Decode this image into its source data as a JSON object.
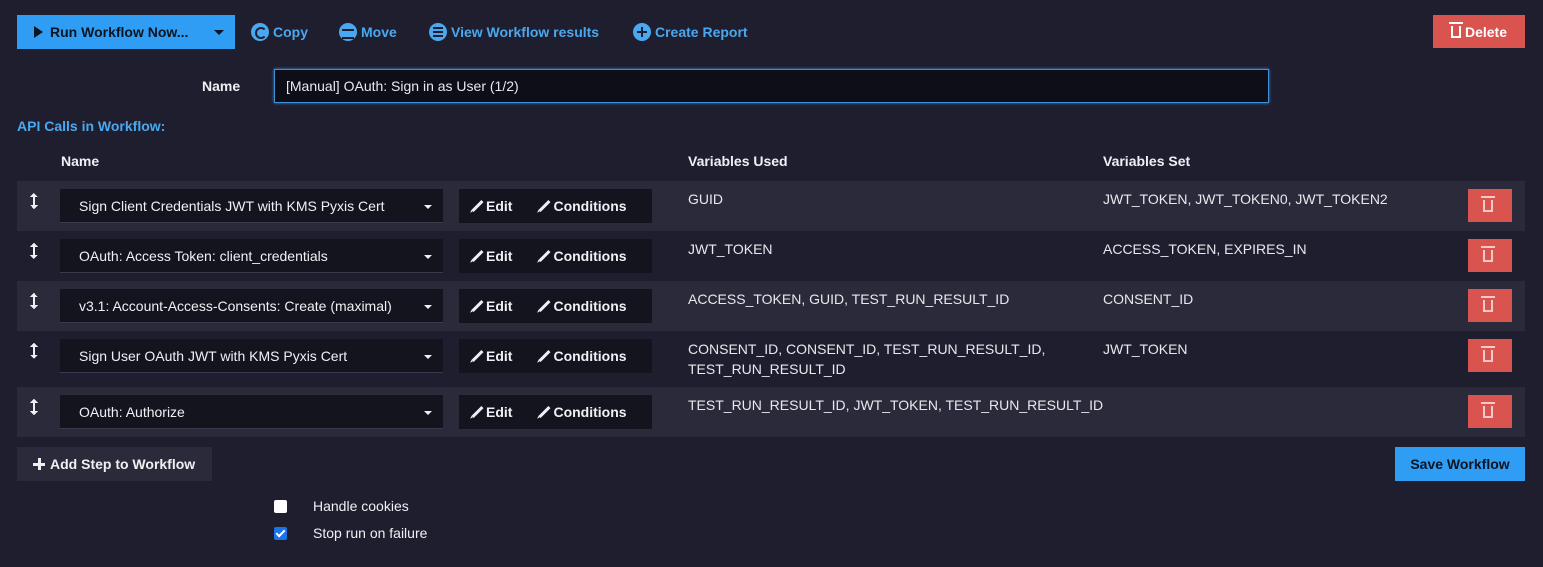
{
  "toolbar": {
    "run_label": "Run Workflow Now...",
    "copy_label": "Copy",
    "move_label": "Move",
    "view_results_label": "View Workflow results",
    "create_report_label": "Create Report",
    "delete_label": "Delete"
  },
  "form": {
    "name_label": "Name",
    "name_value": "[Manual] OAuth: Sign in as User (1/2)"
  },
  "section_title": "API Calls in Workflow:",
  "table": {
    "headers": {
      "name": "Name",
      "variables_used": "Variables Used",
      "variables_set": "Variables Set"
    },
    "edit_label": "Edit",
    "conditions_label": "Conditions",
    "rows": [
      {
        "name": "Sign Client Credentials JWT with KMS Pyxis Cert",
        "variables_used": "GUID",
        "variables_set": "JWT_TOKEN, JWT_TOKEN0, JWT_TOKEN2"
      },
      {
        "name": "OAuth: Access Token: client_credentials",
        "variables_used": "JWT_TOKEN",
        "variables_set": "ACCESS_TOKEN, EXPIRES_IN"
      },
      {
        "name": "v3.1: Account-Access-Consents: Create (maximal)",
        "variables_used": "ACCESS_TOKEN, GUID, TEST_RUN_RESULT_ID",
        "variables_set": "CONSENT_ID"
      },
      {
        "name": "Sign User OAuth JWT with KMS Pyxis Cert",
        "variables_used_line1": "CONSENT_ID, CONSENT_ID, TEST_RUN_RESULT_ID,",
        "variables_used_line2": "TEST_RUN_RESULT_ID",
        "variables_set": "JWT_TOKEN"
      },
      {
        "name": "OAuth: Authorize",
        "variables_used": "TEST_RUN_RESULT_ID, JWT_TOKEN, TEST_RUN_RESULT_ID",
        "variables_set": ""
      }
    ]
  },
  "footer": {
    "add_step_label": "Add Step to Workflow",
    "save_label": "Save Workflow",
    "handle_cookies_label": "Handle cookies",
    "handle_cookies_checked": false,
    "stop_on_failure_label": "Stop run on failure",
    "stop_on_failure_checked": true
  },
  "colors": {
    "background": "#1f1e2e",
    "primary": "#2f9df4",
    "link": "#4aa8f0",
    "danger": "#d9534f"
  }
}
